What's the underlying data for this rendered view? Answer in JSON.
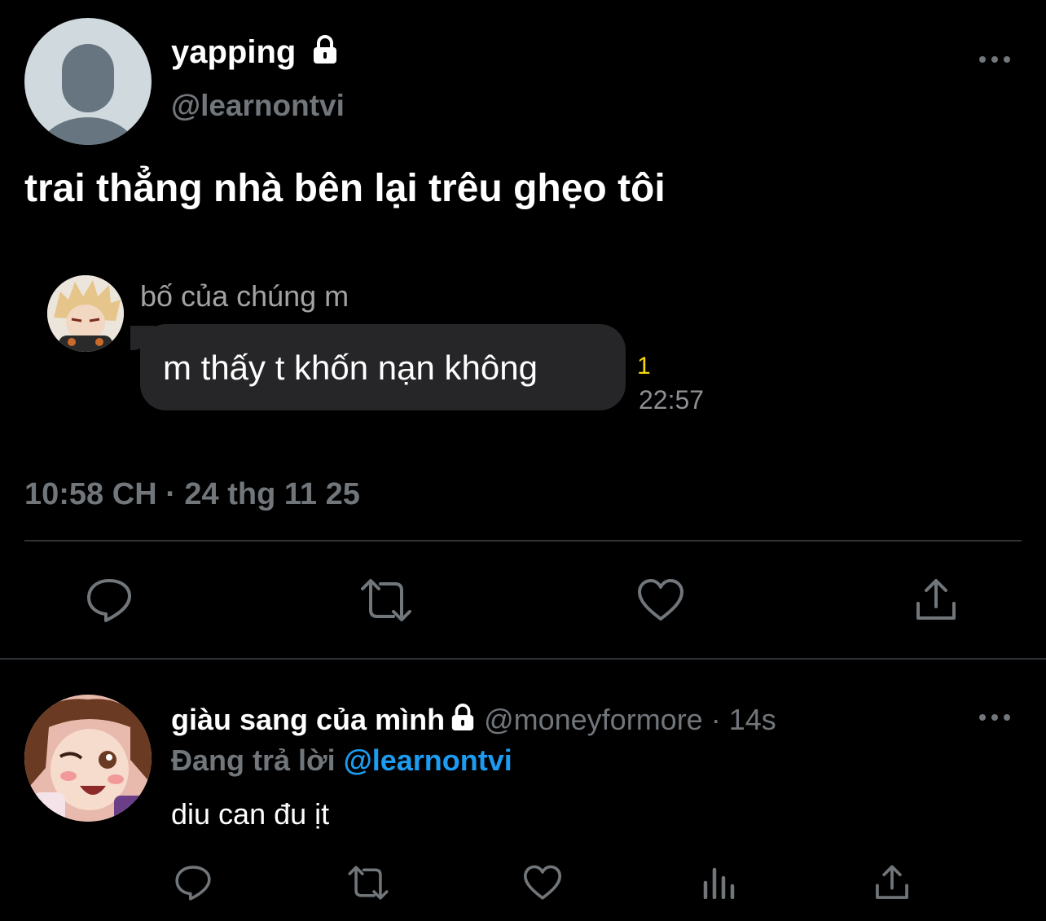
{
  "tweet": {
    "display_name": "yapping",
    "handle": "@learnontvi",
    "text": "trai thẳng nhà bên lại trêu ghẹo tôi",
    "timestamp": "10:58 CH · 24 thg 11 25",
    "locked": true,
    "embedded_message": {
      "sender": "bố của chúng m",
      "message": "m thấy t khốn nạn không",
      "read_count": "1",
      "time": "22:57"
    },
    "actions": [
      "reply-icon",
      "retweet-icon",
      "like-icon",
      "share-icon"
    ]
  },
  "reply": {
    "display_name": "giàu sang của mình",
    "handle": "@moneyformore",
    "time_ago": "· 14s",
    "replying_prefix": "Đang trả lời",
    "replying_to": "@learnontvi",
    "text": "diu can đu ịt",
    "locked": true,
    "actions": [
      "reply-icon",
      "retweet-icon",
      "like-icon",
      "views-icon",
      "share-icon"
    ]
  },
  "colors": {
    "background": "#000000",
    "secondary_text": "#71767b",
    "link": "#1d9bf0",
    "bubble": "#262628",
    "read_count": "#f5d90a",
    "divider": "#2f3336"
  }
}
